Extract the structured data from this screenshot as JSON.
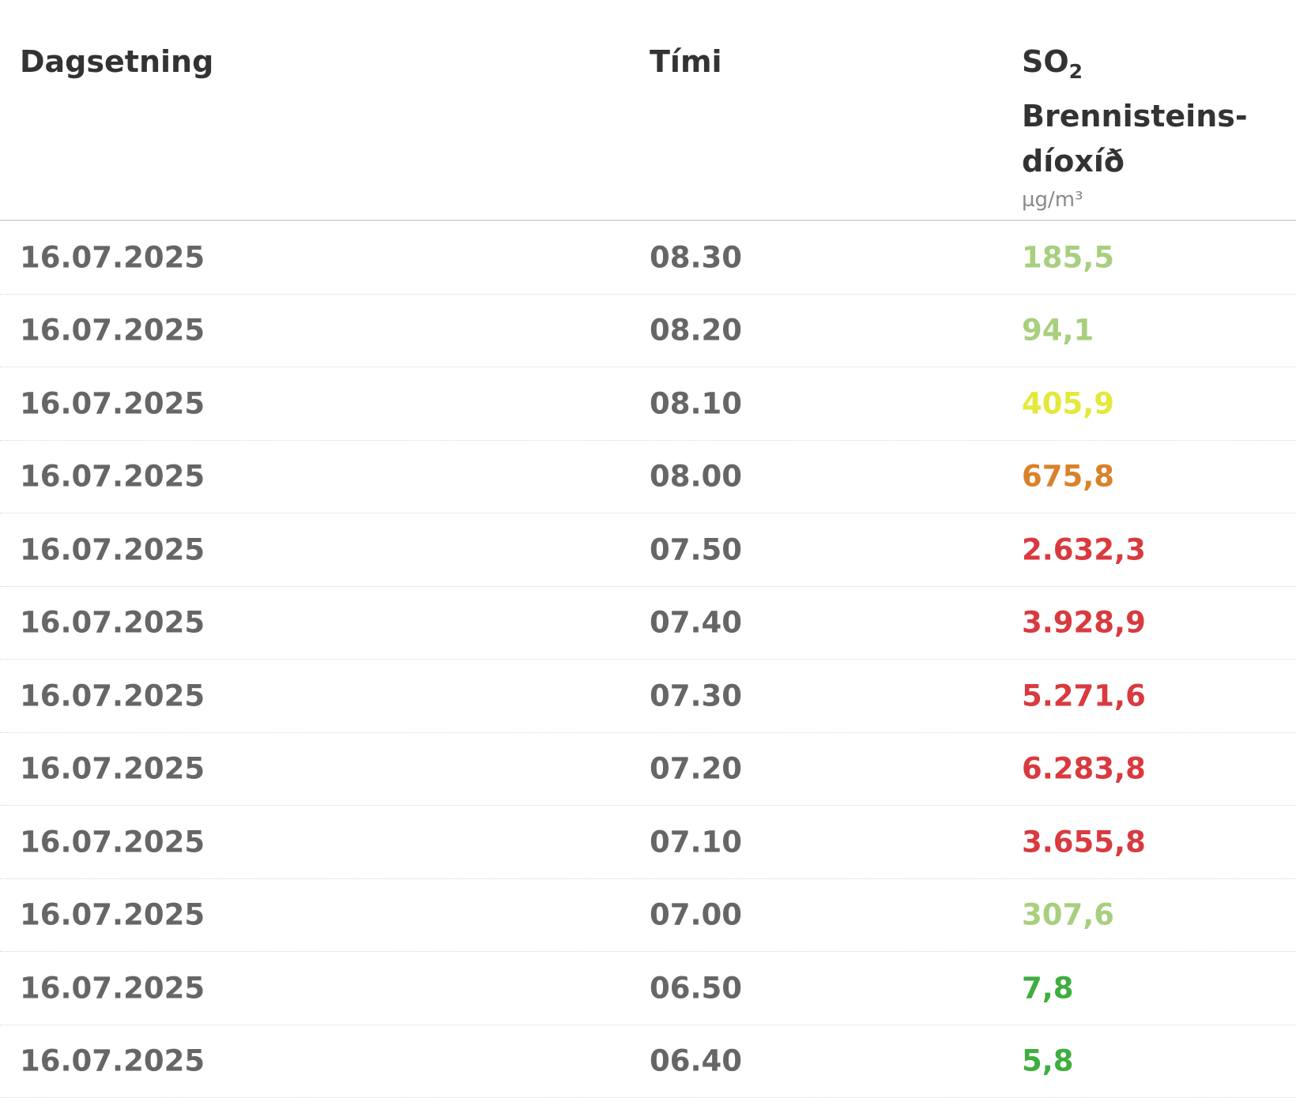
{
  "header": {
    "date_label": "Dagsetning",
    "time_label": "Tími",
    "so2_label": "SO",
    "so2_subscript": "2",
    "so2_name_line1": "Brennisteins-",
    "so2_name_line2": "díoxíð",
    "so2_unit": "µg/m³"
  },
  "rows": [
    {
      "date": "16.07.2025",
      "time": "08.30",
      "value": "185,5",
      "color": "#a8cf7e"
    },
    {
      "date": "16.07.2025",
      "time": "08.20",
      "value": "94,1",
      "color": "#a8cf7e"
    },
    {
      "date": "16.07.2025",
      "time": "08.10",
      "value": "405,9",
      "color": "#e3e83a"
    },
    {
      "date": "16.07.2025",
      "time": "08.00",
      "value": "675,8",
      "color": "#d9822b"
    },
    {
      "date": "16.07.2025",
      "time": "07.50",
      "value": "2.632,3",
      "color": "#d93a3f"
    },
    {
      "date": "16.07.2025",
      "time": "07.40",
      "value": "3.928,9",
      "color": "#d93a3f"
    },
    {
      "date": "16.07.2025",
      "time": "07.30",
      "value": "5.271,6",
      "color": "#d93a3f"
    },
    {
      "date": "16.07.2025",
      "time": "07.20",
      "value": "6.283,8",
      "color": "#d93a3f"
    },
    {
      "date": "16.07.2025",
      "time": "07.10",
      "value": "3.655,8",
      "color": "#d93a3f"
    },
    {
      "date": "16.07.2025",
      "time": "07.00",
      "value": "307,6",
      "color": "#a8cf7e"
    },
    {
      "date": "16.07.2025",
      "time": "06.50",
      "value": "7,8",
      "color": "#3fae3f"
    },
    {
      "date": "16.07.2025",
      "time": "06.40",
      "value": "5,8",
      "color": "#3fae3f"
    }
  ]
}
